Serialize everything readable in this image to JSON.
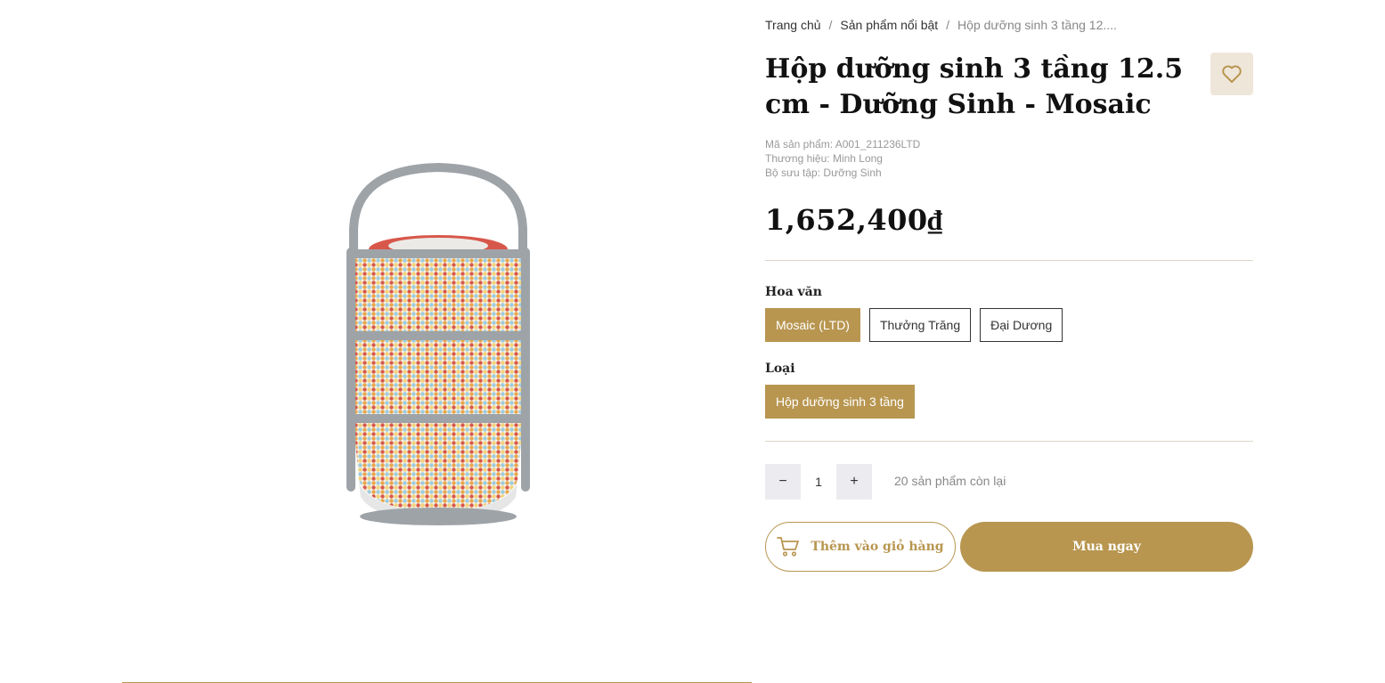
{
  "breadcrumb": {
    "home": "Trang chủ",
    "category": "Sản phẩm nổi bật",
    "current": "Hộp dưỡng sinh 3 tầng 12...."
  },
  "product": {
    "title": "Hộp dưỡng sinh 3 tầng 12.5 cm - Dưỡng Sinh - Mosaic",
    "sku": "Mã sản phẩm: A001_211236LTD",
    "brand": "Thương hiệu: Minh Long",
    "collection": "Bộ sưu tập: Dưỡng Sinh",
    "price": "1,652,400₫",
    "image_icon": "stacked-lunch-box-icon"
  },
  "options": {
    "pattern_label": "Hoa văn",
    "patterns": [
      "Mosaic (LTD)",
      "Thưởng Trăng",
      "Đại Dương"
    ],
    "pattern_selected": "Mosaic (LTD)",
    "type_label": "Loại",
    "types": [
      "Hộp dưỡng sinh 3 tầng"
    ],
    "type_selected": "Hộp dưỡng sinh 3 tầng"
  },
  "quantity": {
    "minus": "−",
    "value": "1",
    "plus": "+",
    "stock_text": "20 sản phẩm còn lại"
  },
  "actions": {
    "add_to_cart": "Thêm vào giỏ hàng",
    "buy_now": "Mua ngay",
    "cart_icon": "cart-icon",
    "wishlist_icon": "heart-icon"
  },
  "colors": {
    "accent": "#b89650",
    "wishlist_bg": "#efe6da",
    "qty_bg": "#ecebf0"
  }
}
